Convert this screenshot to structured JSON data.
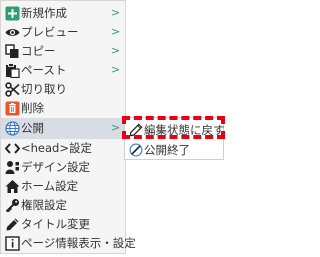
{
  "menu": {
    "items": [
      {
        "label": "新規作成",
        "icon": "plus-square-icon",
        "has_submenu": true
      },
      {
        "label": "プレビュー",
        "icon": "eye-icon",
        "has_submenu": true
      },
      {
        "label": "コピー",
        "icon": "copy-icon",
        "has_submenu": true
      },
      {
        "label": "ペースト",
        "icon": "paste-icon",
        "has_submenu": true
      },
      {
        "label": "切り取り",
        "icon": "scissors-icon",
        "has_submenu": false
      },
      {
        "label": "削除",
        "icon": "trash-icon",
        "has_submenu": false
      },
      {
        "label": "公開",
        "icon": "globe-icon",
        "has_submenu": true,
        "active": true
      },
      {
        "label": "<head>設定",
        "icon": "code-icon",
        "has_submenu": false
      },
      {
        "label": "デザイン設定",
        "icon": "user-design-icon",
        "has_submenu": false
      },
      {
        "label": "ホーム設定",
        "icon": "home-icon",
        "has_submenu": false
      },
      {
        "label": "権限設定",
        "icon": "key-icon",
        "has_submenu": false
      },
      {
        "label": "タイトル変更",
        "icon": "pencil-icon",
        "has_submenu": false
      },
      {
        "label": "ページ情報表示・設定",
        "icon": "info-icon",
        "has_submenu": false
      }
    ],
    "submenu_arrow": ">"
  },
  "submenu": {
    "items": [
      {
        "label": "編集状態に戻す",
        "icon": "pencil-icon"
      },
      {
        "label": "公開終了",
        "icon": "unpublish-icon"
      }
    ]
  },
  "colors": {
    "accent_green": "#2f9d6e",
    "delete_orange": "#e8562a",
    "highlight_red": "#e60012",
    "active_bg": "#d8dde3"
  }
}
